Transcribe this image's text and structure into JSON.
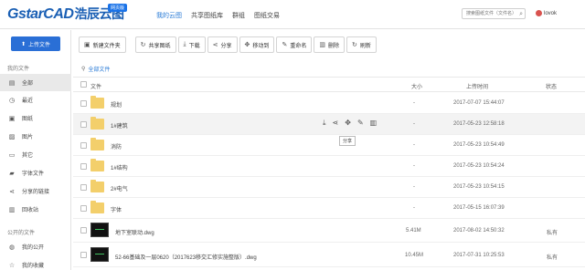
{
  "header": {
    "logo_main": "Gstar",
    "logo_cad": "CAD",
    "logo_cn": "浩辰云图",
    "badge": "网页版",
    "nav": [
      {
        "label": "我的云图",
        "active": true
      },
      {
        "label": "共享图纸库",
        "active": false
      },
      {
        "label": "群组",
        "active": false
      },
      {
        "label": "图纸交易",
        "active": false
      }
    ],
    "search_placeholder": "搜索图纸文件（文件名）",
    "username": "lovok"
  },
  "sidebar": {
    "upload_label": "上传文件",
    "group_my": "我的文件",
    "items_my": [
      {
        "label": "全部",
        "icon": "folder-icon",
        "active": true
      },
      {
        "label": "最近",
        "icon": "clock-icon"
      },
      {
        "label": "图纸",
        "icon": "drawing-icon"
      },
      {
        "label": "图片",
        "icon": "image-icon"
      },
      {
        "label": "其它",
        "icon": "file-icon"
      },
      {
        "label": "字体文件",
        "icon": "font-icon"
      },
      {
        "label": "分享的链接",
        "icon": "share-icon"
      },
      {
        "label": "回收站",
        "icon": "trash-icon"
      }
    ],
    "group_public": "公开的文件",
    "items_public": [
      {
        "label": "我的公开",
        "icon": "globe-icon"
      },
      {
        "label": "我的收藏",
        "icon": "star-icon"
      }
    ]
  },
  "toolbar": {
    "new_folder": "新建文件夹",
    "share_drawing": "共享图纸",
    "download": "下载",
    "share": "分享",
    "move": "移动到",
    "rename": "重命名",
    "delete": "删除",
    "refresh": "刷新"
  },
  "breadcrumb": "全部文件",
  "table": {
    "col_file": "文件",
    "col_size": "大小",
    "col_time": "上传时间",
    "col_status": "状态",
    "rows": [
      {
        "type": "folder",
        "name": "规划",
        "size": "-",
        "time": "2017-07-07 15:44:07",
        "status": ""
      },
      {
        "type": "folder",
        "name": "1#建筑",
        "size": "-",
        "time": "2017-05-23 12:58:18",
        "status": ""
      },
      {
        "type": "folder",
        "name": "消防",
        "size": "-",
        "time": "2017-05-23 10:54:49",
        "status": ""
      },
      {
        "type": "folder",
        "name": "1#结构",
        "size": "-",
        "time": "2017-05-23 10:54:24",
        "status": ""
      },
      {
        "type": "folder",
        "name": "2#电气",
        "size": "-",
        "time": "2017-05-23 10:54:15",
        "status": ""
      },
      {
        "type": "folder",
        "name": "字体",
        "size": "-",
        "time": "2017-05-15 16:07:39",
        "status": ""
      },
      {
        "type": "dwg",
        "name": "地下室联动.dwg",
        "size": "5.41M",
        "time": "2017-08-02 14:50:32",
        "status": "私有"
      },
      {
        "type": "dwg",
        "name": "52-66基础及一层0620（2017623移交汇修实施整版）.dwg",
        "size": "10.45M",
        "time": "2017-07-31 10:25:53",
        "status": "私有"
      }
    ]
  },
  "tooltip": "分享"
}
